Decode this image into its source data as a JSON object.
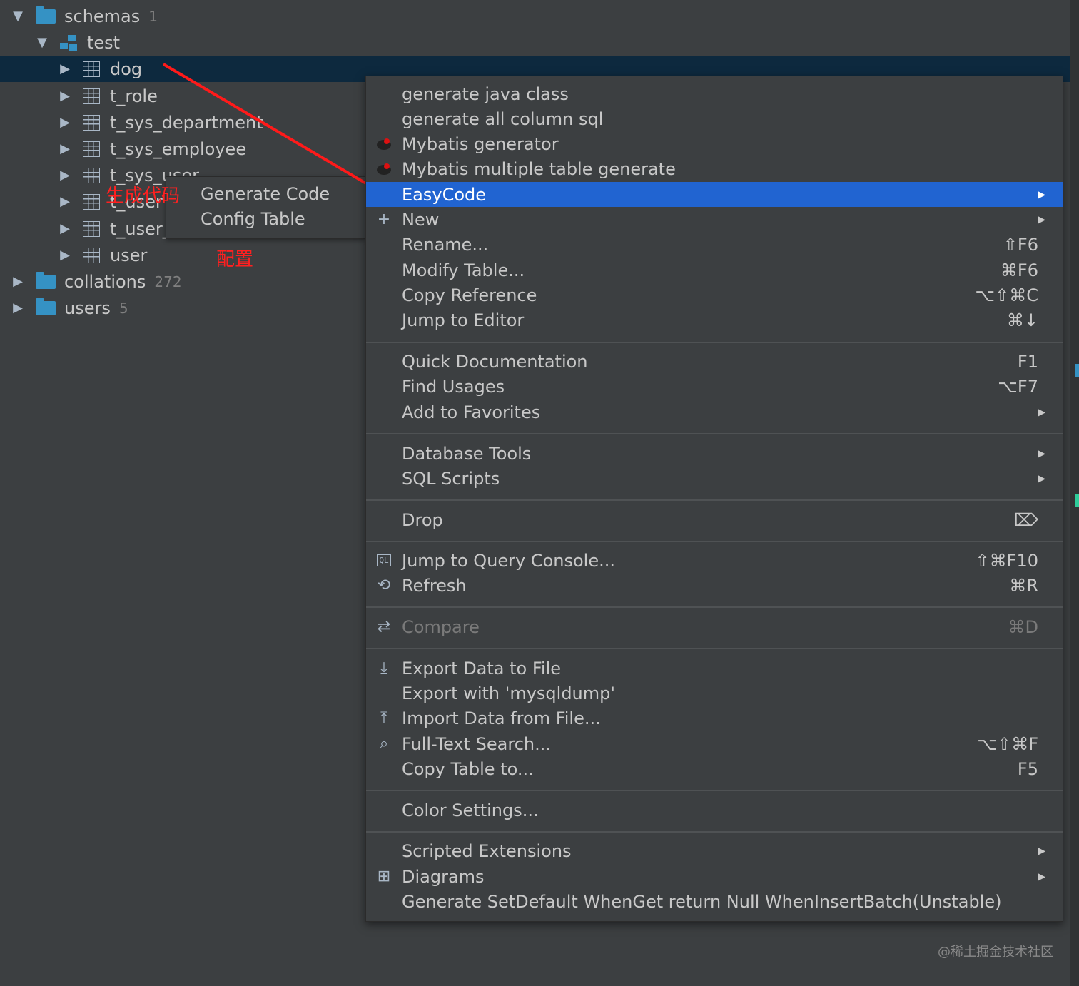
{
  "tree": {
    "schemas": {
      "label": "schemas",
      "count": "1"
    },
    "test": {
      "label": "test"
    },
    "tables": [
      "dog",
      "t_role",
      "t_sys_department",
      "t_sys_employee",
      "t_sys_user",
      "t_user",
      "t_user_",
      "user"
    ],
    "collations": {
      "label": "collations",
      "count": "272"
    },
    "users": {
      "label": "users",
      "count": "5"
    }
  },
  "easycode_submenu": {
    "items": [
      "Generate Code",
      "Config Table"
    ]
  },
  "annotations": {
    "generate_code": "生成代码",
    "config": "配置"
  },
  "context_menu": {
    "items": [
      {
        "label": "generate java class",
        "shortcut": "",
        "icon": "",
        "submenu": false
      },
      {
        "label": "generate all column sql",
        "shortcut": "",
        "icon": "",
        "submenu": false
      },
      {
        "label": "Mybatis generator",
        "shortcut": "",
        "icon": "mybatis-bird-icon",
        "submenu": false
      },
      {
        "label": "Mybatis multiple table generate",
        "shortcut": "",
        "icon": "mybatis-bird-icon",
        "submenu": false
      },
      {
        "label": "EasyCode",
        "shortcut": "",
        "icon": "",
        "submenu": true,
        "highlighted": true
      },
      {
        "label": "New",
        "shortcut": "",
        "icon": "plus-icon",
        "submenu": true
      },
      {
        "label": "Rename...",
        "shortcut": "⇧F6",
        "icon": "",
        "submenu": false
      },
      {
        "label": "Modify Table...",
        "shortcut": "⌘F6",
        "icon": "",
        "submenu": false
      },
      {
        "label": "Copy Reference",
        "shortcut": "⌥⇧⌘C",
        "icon": "",
        "submenu": false
      },
      {
        "label": "Jump to Editor",
        "shortcut": "⌘↓",
        "icon": "",
        "submenu": false
      },
      {
        "label": "Quick Documentation",
        "shortcut": "F1",
        "icon": "",
        "submenu": false
      },
      {
        "label": "Find Usages",
        "shortcut": "⌥F7",
        "icon": "",
        "submenu": false
      },
      {
        "label": "Add to Favorites",
        "shortcut": "",
        "icon": "",
        "submenu": true
      },
      {
        "label": "Database Tools",
        "shortcut": "",
        "icon": "",
        "submenu": true
      },
      {
        "label": "SQL Scripts",
        "shortcut": "",
        "icon": "",
        "submenu": true
      },
      {
        "label": "Drop",
        "shortcut": "⌦",
        "icon": "",
        "submenu": false
      },
      {
        "label": "Jump to Query Console...",
        "shortcut": "⇧⌘F10",
        "icon": "query-console-icon",
        "submenu": false
      },
      {
        "label": "Refresh",
        "shortcut": "⌘R",
        "icon": "refresh-icon",
        "submenu": false
      },
      {
        "label": "Compare",
        "shortcut": "⌘D",
        "icon": "compare-icon",
        "submenu": false,
        "disabled": true
      },
      {
        "label": "Export Data to File",
        "shortcut": "",
        "icon": "export-icon",
        "submenu": false
      },
      {
        "label": "Export with 'mysqldump'",
        "shortcut": "",
        "icon": "",
        "submenu": false
      },
      {
        "label": "Import Data from File...",
        "shortcut": "",
        "icon": "import-icon",
        "submenu": false
      },
      {
        "label": "Full-Text Search...",
        "shortcut": "⌥⇧⌘F",
        "icon": "search-icon",
        "submenu": false
      },
      {
        "label": "Copy Table to...",
        "shortcut": "F5",
        "icon": "",
        "submenu": false
      },
      {
        "label": "Color Settings...",
        "shortcut": "",
        "icon": "",
        "submenu": false
      },
      {
        "label": "Scripted Extensions",
        "shortcut": "",
        "icon": "",
        "submenu": true
      },
      {
        "label": "Diagrams",
        "shortcut": "",
        "icon": "diagrams-icon",
        "submenu": true
      },
      {
        "label": "Generate SetDefault WhenGet return Null WhenInsertBatch(Unstable)",
        "shortcut": "",
        "icon": "",
        "submenu": false
      }
    ]
  },
  "watermark": "@稀土掘金技术社区",
  "colors": {
    "background": "#3c3f41",
    "selection": "#0d293e",
    "highlight": "#2164d1",
    "folder": "#3592c4",
    "annotation": "#ff2020"
  }
}
